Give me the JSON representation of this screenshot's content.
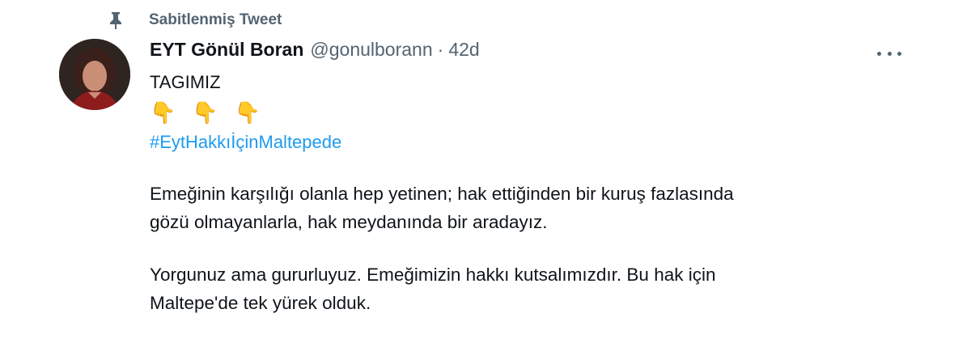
{
  "pinned": {
    "label": "Sabitlenmiş Tweet",
    "icon": "pin-icon"
  },
  "author": {
    "display_name": "EYT Gönül Boran",
    "handle": "@gonulborann",
    "separator": "·",
    "time": "42d"
  },
  "tweet": {
    "line1": "TAGIMIZ",
    "emojis": [
      "👇",
      "👇",
      "👇"
    ],
    "hashtag": "#EytHakkıİçinMaltepede",
    "para1_line1": "Emeğinin karşılığı olanla hep yetinen; hak ettiğinden bir kuruş fazlasında",
    "para1_line2": "gözü olmayanlarla, hak meydanında bir aradayız.",
    "para2_line1": "Yorgunuz ama gururluyuz. Emeğimizin hakkı kutsalımızdır. Bu hak için",
    "para2_line2": "Maltepe'de tek yürek olduk."
  },
  "more_icon": "more-horizontal-icon",
  "colors": {
    "text": "#0f1419",
    "secondary": "#536471",
    "link": "#1d9bf0",
    "emoji": "#f5c33b"
  }
}
